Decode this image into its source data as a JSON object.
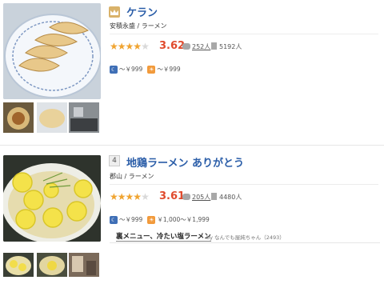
{
  "shops": [
    {
      "name": "ケラン",
      "area_genre": "安積永盛 / ラーメン",
      "rating": "3.62",
      "stars_full": 3,
      "stars_half": 1,
      "reviews": "252人",
      "bookmarks": "5192人",
      "dinner_price": "～￥999",
      "lunch_price": "～￥999"
    },
    {
      "rank": "4",
      "name": "地鶏ラーメン ありがとう",
      "area_genre": "郡山 / ラーメン",
      "rating": "3.61",
      "stars_full": 3,
      "stars_half": 1,
      "reviews": "205人",
      "bookmarks": "4480人",
      "dinner_price": "～￥999",
      "lunch_price": "￥1,000～￥1,999",
      "review_title": "裏メニュー、冷たい塩ラーメン",
      "review_by": "by なんでも屋純ちゃん（2493）"
    }
  ],
  "icons": {
    "crown": "crown-icon",
    "comment": "comment-icon",
    "bookmark": "bookmark-icon",
    "dinner": "moon-icon",
    "lunch": "sun-icon"
  },
  "colors": {
    "link": "#2a5da8",
    "score": "#e04a2d",
    "star": "#f0a431"
  }
}
